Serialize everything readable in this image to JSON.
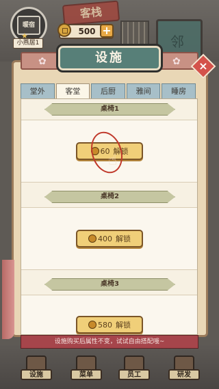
{
  "hud": {
    "shop_sign": "客栈",
    "avatar_text": "暖宿",
    "shop_name": "小燕居1",
    "coins": "500",
    "plus": "+"
  },
  "panel": {
    "title": "设施",
    "close": "×",
    "tabs": [
      {
        "label": "堂外",
        "active": false
      },
      {
        "label": "客堂",
        "active": true
      },
      {
        "label": "后厨",
        "active": false
      },
      {
        "label": "雅间",
        "active": false
      },
      {
        "label": "睡房",
        "active": false
      }
    ],
    "items": [
      {
        "title": "桌椅1",
        "price": "60",
        "action": "解锁"
      },
      {
        "title": "桌椅2",
        "price": "400",
        "action": "解锁"
      },
      {
        "title": "桌椅3",
        "price": "580",
        "action": "解锁"
      }
    ],
    "tip": "设施购买后属性不变，试试自由搭配哦~"
  },
  "nav": [
    {
      "label": "设施"
    },
    {
      "label": "菜单"
    },
    {
      "label": "员工"
    },
    {
      "label": "研发"
    }
  ],
  "colors": {
    "plaque": "#577f78",
    "tab_inactive": "#a7bfc8",
    "button": "#f0cf79",
    "tip_bar": "#a6454b"
  }
}
